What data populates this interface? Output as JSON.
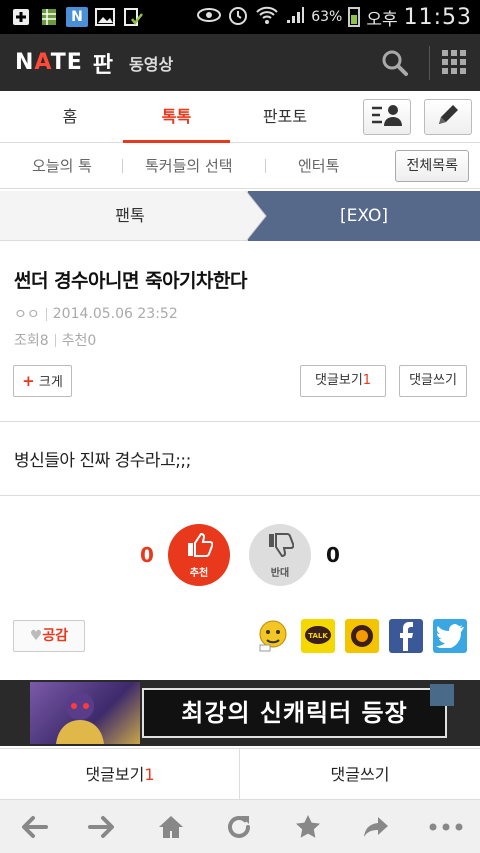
{
  "status_bar": {
    "time": "11:53",
    "ampm": "오후",
    "battery": "63%",
    "notification_icons": [
      "plus-box-icon",
      "sheet-icon",
      "nate-n-icon",
      "image-icon",
      "download-check-icon"
    ]
  },
  "header": {
    "logo": "NATE",
    "service": "판",
    "video": "동영상"
  },
  "tabs": [
    {
      "label": "홈",
      "active": false
    },
    {
      "label": "톡톡",
      "active": true
    },
    {
      "label": "판포토",
      "active": false
    }
  ],
  "subtabs": {
    "items": [
      "오늘의 톡",
      "톡커들의 선택",
      "엔터톡"
    ],
    "all_list": "전체목록"
  },
  "breadcrumb": {
    "left": "팬톡",
    "right": "[EXO]"
  },
  "article": {
    "title": "썬더 경수아니면 죽아기차한다",
    "author": "ㅇㅇ",
    "date": "2014.05.06 23:52",
    "views": "조회8",
    "recommend": "추천0",
    "enlarge": "크게",
    "view_comments": "댓글보기",
    "comment_count": "1",
    "write_comment": "댓글쓰기",
    "body": "병신들아 진짜 경수라고;;;"
  },
  "votes": {
    "up_count": "0",
    "up_label": "추천",
    "down_count": "0",
    "down_label": "반대"
  },
  "empathy": "공감",
  "share_icons": [
    "emoji-icon",
    "kakaotalk-icon",
    "kakaostory-icon",
    "facebook-icon",
    "twitter-icon"
  ],
  "ad": {
    "text": "최강의 신캐릭터 등장"
  },
  "bottom_actions": {
    "view_comments": "댓글보기",
    "comment_count": "1",
    "write_comment": "댓글쓰기"
  },
  "colors": {
    "accent": "#e8391c",
    "header_bg": "#2b2b2b",
    "category_bg": "#56698a"
  }
}
